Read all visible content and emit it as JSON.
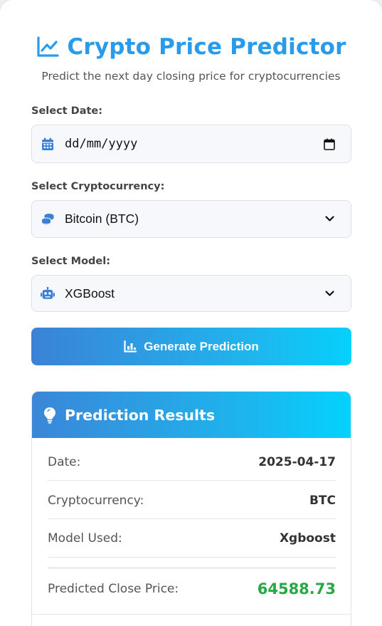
{
  "header": {
    "title": "Crypto Price Predictor",
    "subtitle": "Predict the next day closing price for cryptocurrencies"
  },
  "form": {
    "date": {
      "label": "Select Date:",
      "placeholder": "dd/mm/yyyy"
    },
    "crypto": {
      "label": "Select Cryptocurrency:",
      "selected": "Bitcoin (BTC)"
    },
    "model": {
      "label": "Select Model:",
      "selected": "XGBoost"
    },
    "submit_label": "Generate Prediction"
  },
  "results": {
    "title": "Prediction Results",
    "rows": [
      {
        "key": "Date:",
        "value": "2025-04-17"
      },
      {
        "key": "Cryptocurrency:",
        "value": "BTC"
      },
      {
        "key": "Model Used:",
        "value": "Xgboost"
      }
    ],
    "predicted_label": "Predicted Close Price:",
    "predicted_value": "64588.73"
  },
  "colors": {
    "accent": "#2a9bea",
    "gradient_start": "#3b82d6",
    "gradient_end": "#06d0fb",
    "price": "#28a745"
  },
  "icons": {
    "title": "chart-line-icon",
    "date": "calendar-icon",
    "crypto": "coins-icon",
    "model": "robot-icon",
    "button": "chart-bar-icon",
    "results": "lightbulb-icon"
  }
}
